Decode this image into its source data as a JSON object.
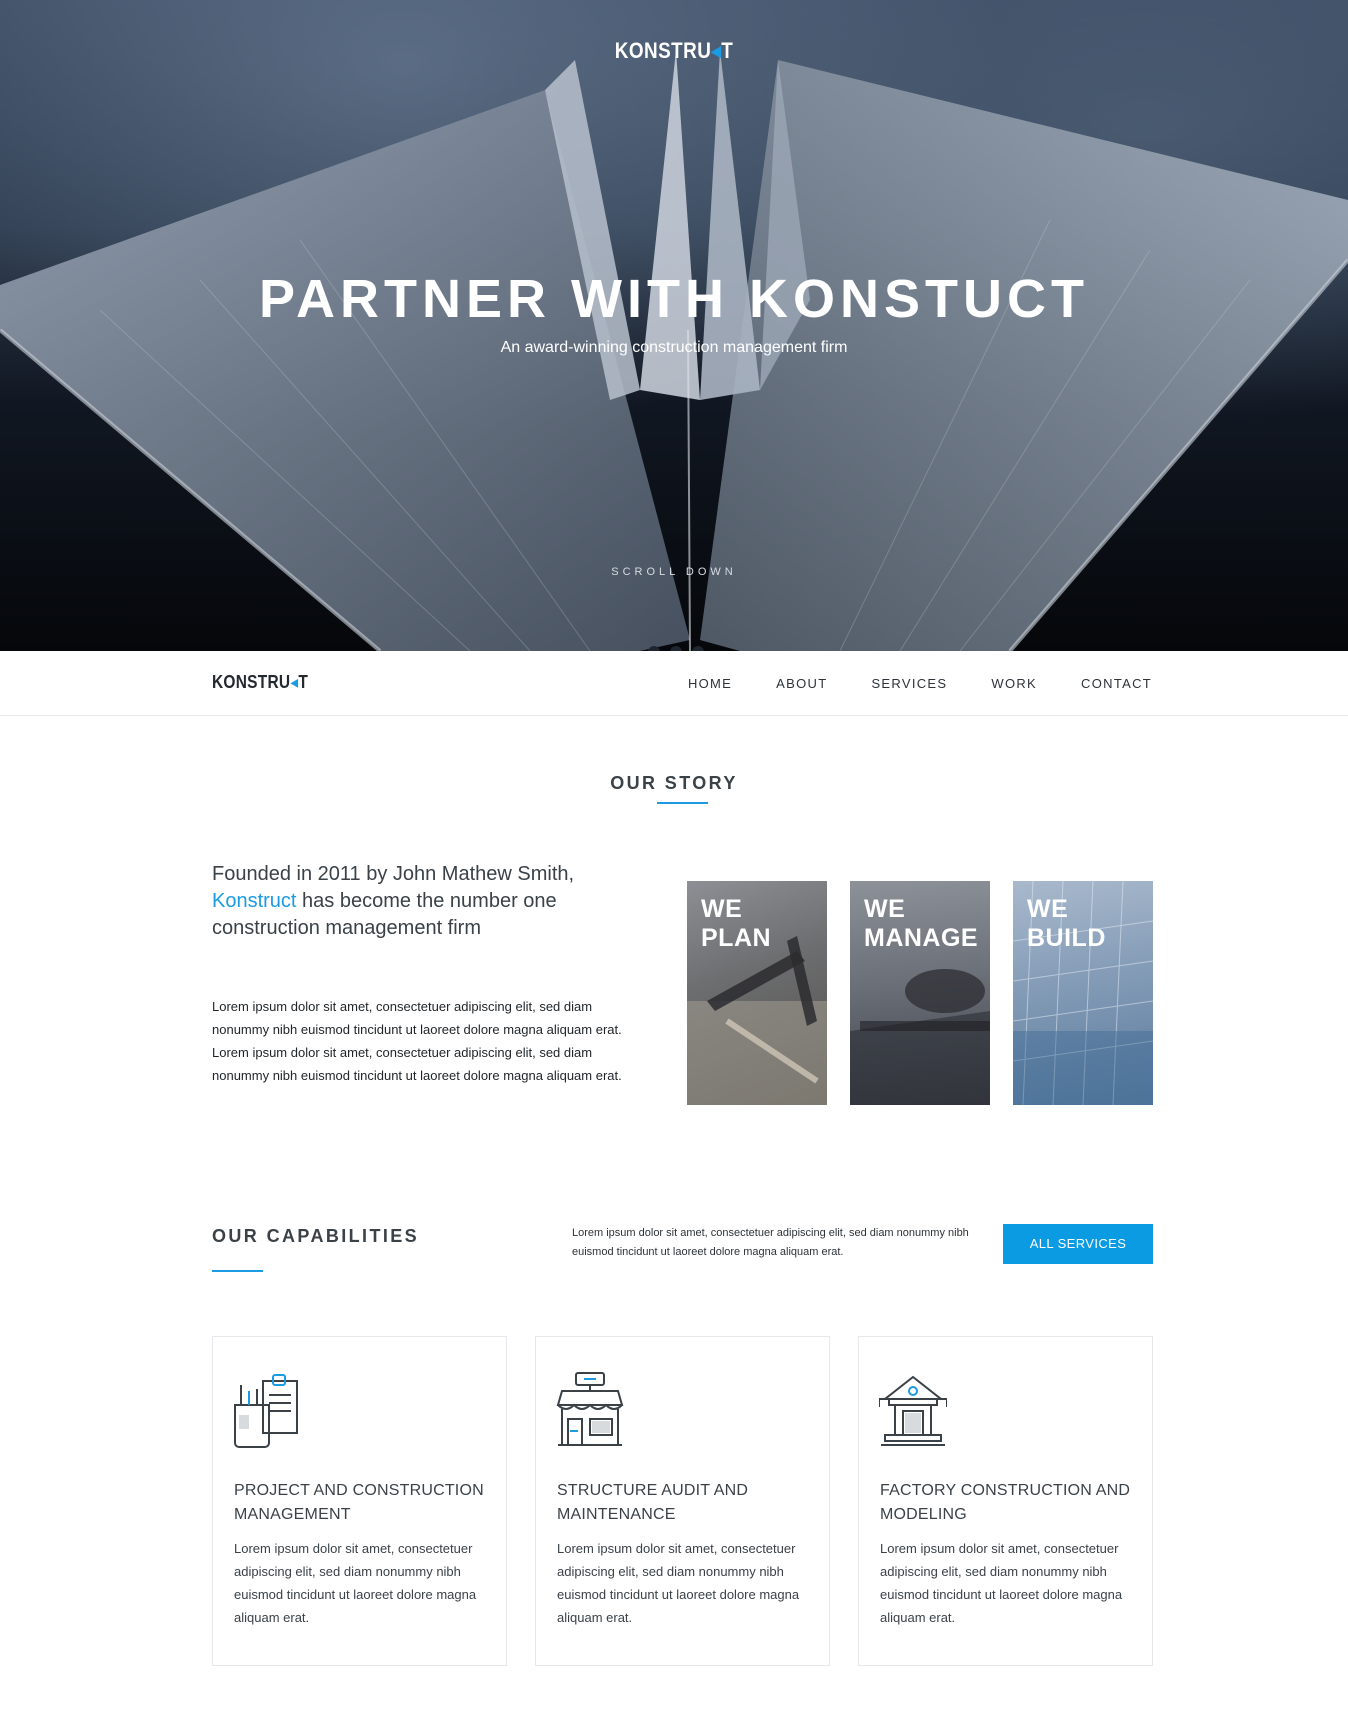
{
  "hero": {
    "logo_main": "KONSTRU",
    "logo_accent": "◂",
    "logo_end": "T",
    "title": "PARTNER WITH KONSTUCT",
    "subtitle": "An award-winning construction management firm",
    "scroll_label": "SCROLL DOWN"
  },
  "nav": {
    "logo_main": "KONSTRU",
    "logo_accent": "◂",
    "logo_end": "T",
    "links": [
      "HOME",
      "ABOUT",
      "SERVICES",
      "WORK",
      "CONTACT"
    ]
  },
  "story": {
    "title": "OUR STORY",
    "lead_before": "Founded in 2011 by John Mathew Smith,",
    "lead_accent": "Konstruct",
    "lead_after": "has become the number one construction management firm",
    "body": "Lorem ipsum dolor sit amet, consectetuer adipiscing elit, sed diam nonummy nibh euismod tincidunt ut laoreet dolore magna aliquam erat. Lorem ipsum dolor sit amet, consectetuer adipiscing elit, sed diam nonummy nibh euismod tincidunt ut laoreet dolore magna aliquam erat.",
    "tiles": [
      {
        "line1": "WE",
        "line2": "PLAN"
      },
      {
        "line1": "WE",
        "line2": "MANAGE"
      },
      {
        "line1": "WE",
        "line2": "BUILD"
      }
    ]
  },
  "capabilities": {
    "title": "OUR CAPABILITIES",
    "description": "Lorem ipsum dolor sit amet, consectetuer adipiscing elit, sed diam nonummy nibh euismod tincidunt ut laoreet dolore magna aliquam erat.",
    "button_label": "ALL SERVICES",
    "cards": [
      {
        "icon": "office-supplies-icon",
        "title": "PROJECT AND CONSTRUCTION MANAGEMENT",
        "text": "Lorem ipsum dolor sit amet, consectetuer adipiscing elit, sed diam nonummy nibh euismod tincidunt ut laoreet dolore magna aliquam erat."
      },
      {
        "icon": "storefront-icon",
        "title": "STRUCTURE AUDIT AND MAINTENANCE",
        "text": "Lorem ipsum dolor sit amet, consectetuer adipiscing elit, sed diam nonummy nibh euismod tincidunt ut laoreet dolore magna aliquam erat."
      },
      {
        "icon": "bank-building-icon",
        "title": "FACTORY CONSTRUCTION AND MODELING",
        "text": "Lorem ipsum dolor sit amet, consectetuer adipiscing elit, sed diam nonummy nibh euismod tincidunt ut laoreet dolore magna aliquam erat."
      }
    ]
  },
  "colors": {
    "accent": "#0a9be3",
    "text_dark": "#2f3437"
  }
}
